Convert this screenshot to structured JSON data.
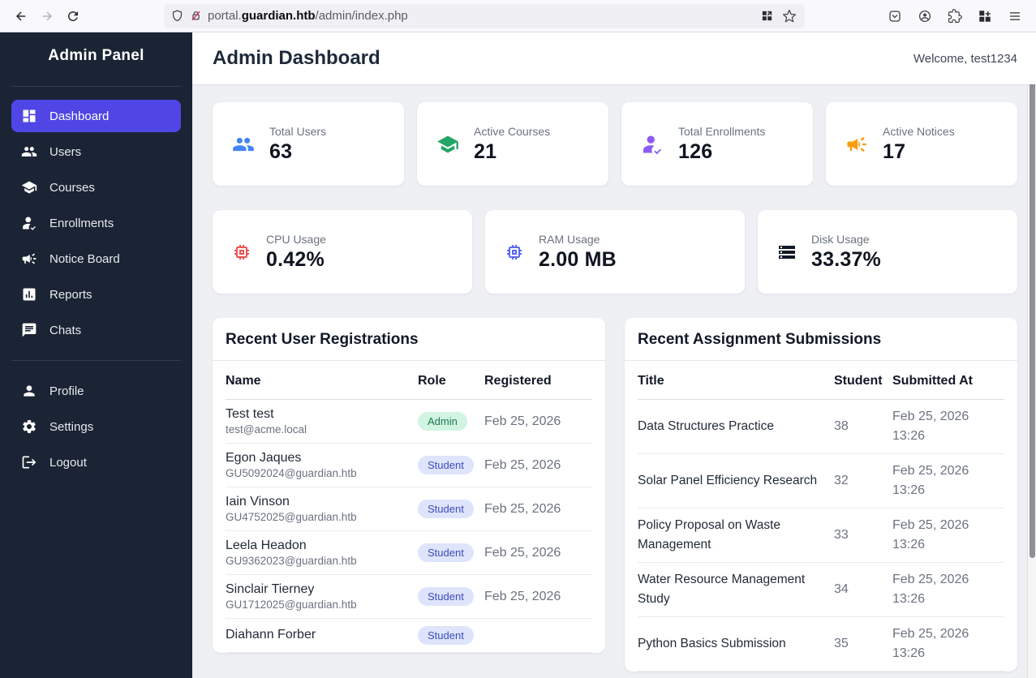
{
  "browser": {
    "url": {
      "prefix": "portal.",
      "domain": "guardian.htb",
      "path": "/admin/index.php"
    }
  },
  "colors": {
    "accent": "#4f46e5",
    "sidebar_bg": "#1b2434",
    "admin_badge_bg": "#d2f4e2",
    "admin_badge_text": "#1a7a4f",
    "student_badge_bg": "#dee4fb",
    "student_badge_text": "#3d4db7",
    "scrollbar_thumb": "#8f8f96"
  },
  "sidebar": {
    "title": "Admin Panel",
    "items": [
      {
        "label": "Dashboard",
        "icon": "dashboard-icon",
        "active": true
      },
      {
        "label": "Users",
        "icon": "users-icon"
      },
      {
        "label": "Courses",
        "icon": "graduation-cap-icon"
      },
      {
        "label": "Enrollments",
        "icon": "person-check-icon"
      },
      {
        "label": "Notice Board",
        "icon": "megaphone-icon"
      },
      {
        "label": "Reports",
        "icon": "bar-chart-icon"
      },
      {
        "label": "Chats",
        "icon": "chat-icon"
      }
    ],
    "footer_items": [
      {
        "label": "Profile",
        "icon": "person-icon"
      },
      {
        "label": "Settings",
        "icon": "gear-icon"
      },
      {
        "label": "Logout",
        "icon": "logout-icon"
      }
    ]
  },
  "header": {
    "title": "Admin Dashboard",
    "welcome": "Welcome, test1234"
  },
  "stats": [
    {
      "label": "Total Users",
      "value": "63",
      "color": "#4285f4"
    },
    {
      "label": "Active Courses",
      "value": "21",
      "color": "#22a565"
    },
    {
      "label": "Total Enrollments",
      "value": "126",
      "color": "#8b5cf6"
    },
    {
      "label": "Active Notices",
      "value": "17",
      "color": "#f59e0b"
    }
  ],
  "system_stats": [
    {
      "label": "CPU Usage",
      "value": "0.42%",
      "color": "#ef5350"
    },
    {
      "label": "RAM Usage",
      "value": "2.00 MB",
      "color": "#5c67f5"
    },
    {
      "label": "Disk Usage",
      "value": "33.37%",
      "color": "#111827"
    }
  ],
  "registrations": {
    "title": "Recent User Registrations",
    "columns": {
      "name": "Name",
      "role": "Role",
      "registered": "Registered"
    },
    "rows": [
      {
        "name": "Test test",
        "email": "test@acme.local",
        "role": "Admin",
        "role_type": "admin",
        "date": "Feb 25, 2026"
      },
      {
        "name": "Egon Jaques",
        "email": "GU5092024@guardian.htb",
        "role": "Student",
        "role_type": "student",
        "date": "Feb 25, 2026"
      },
      {
        "name": "Iain Vinson",
        "email": "GU4752025@guardian.htb",
        "role": "Student",
        "role_type": "student",
        "date": "Feb 25, 2026"
      },
      {
        "name": "Leela Headon",
        "email": "GU9362023@guardian.htb",
        "role": "Student",
        "role_type": "student",
        "date": "Feb 25, 2026"
      },
      {
        "name": "Sinclair Tierney",
        "email": "GU1712025@guardian.htb",
        "role": "Student",
        "role_type": "student",
        "date": "Feb 25, 2026"
      },
      {
        "name": "Diahann Forber",
        "email": "",
        "role": "Student",
        "role_type": "student",
        "date": ""
      }
    ]
  },
  "submissions": {
    "title": "Recent Assignment Submissions",
    "columns": {
      "title": "Title",
      "student": "Student",
      "submitted": "Submitted At"
    },
    "rows": [
      {
        "title": "Data Structures Practice",
        "student": "38",
        "date": "Feb 25, 2026",
        "time": "13:26"
      },
      {
        "title": "Solar Panel Efficiency Research",
        "student": "32",
        "date": "Feb 25, 2026",
        "time": "13:26"
      },
      {
        "title": "Policy Proposal on Waste Management",
        "student": "33",
        "date": "Feb 25, 2026",
        "time": "13:26"
      },
      {
        "title": "Water Resource Management Study",
        "student": "34",
        "date": "Feb 25, 2026",
        "time": "13:26"
      },
      {
        "title": "Python Basics Submission",
        "student": "35",
        "date": "Feb 25, 2026",
        "time": "13:26"
      }
    ]
  }
}
